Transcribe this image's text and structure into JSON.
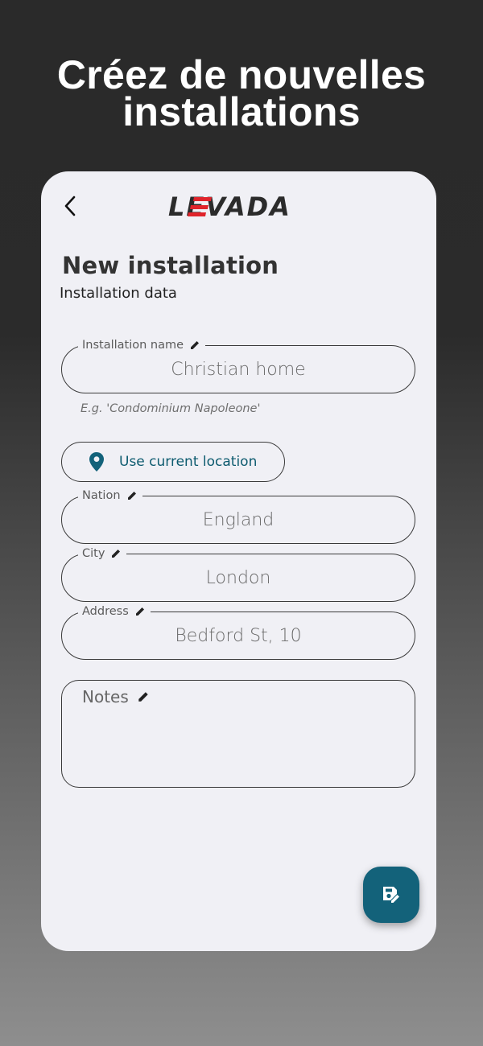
{
  "promo": {
    "title_line1": "Créez de nouvelles",
    "title_line2": "installations"
  },
  "app": {
    "logo_text": "LEVADA",
    "page_title": "New installation",
    "page_subtitle": "Installation data"
  },
  "form": {
    "installation_name": {
      "label": "Installation name",
      "value": "Christian home",
      "hint": "E.g. 'Condominium Napoleone'"
    },
    "use_location_label": "Use current location",
    "nation": {
      "label": "Nation",
      "value": "England"
    },
    "city": {
      "label": "City",
      "value": "London"
    },
    "address": {
      "label": "Address",
      "value": "Bedford St, 10"
    },
    "notes": {
      "label": "Notes",
      "value": ""
    }
  },
  "icons": {
    "back": "chevron-left-icon",
    "edit": "pencil-icon",
    "location": "map-pin-icon",
    "save": "save-edit-icon"
  },
  "colors": {
    "accent": "#13627a",
    "link": "#0d5b6f",
    "logo_red": "#e0242b",
    "logo_dark": "#2b2b2b"
  }
}
